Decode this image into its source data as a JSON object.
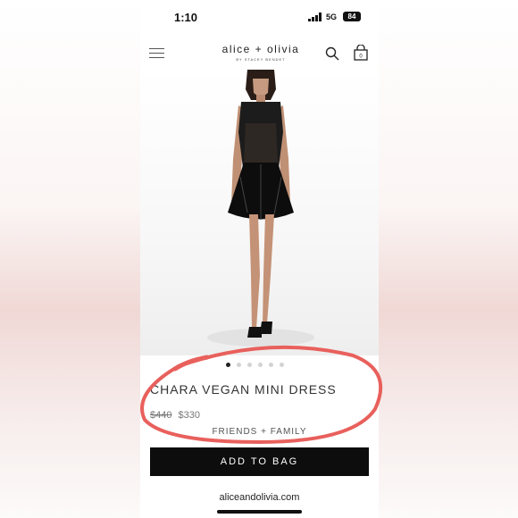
{
  "status_bar": {
    "time": "1:10",
    "network": "5G",
    "battery": "84"
  },
  "header": {
    "logo": "alice + olivia",
    "logo_subtitle": "BY STACEY BENDET",
    "bag_count": "0"
  },
  "icons": {
    "menu": "menu-icon",
    "search": "search-icon",
    "bag": "bag-icon"
  },
  "product": {
    "title": "CHARA VEGAN MINI DRESS",
    "original_price": "$440",
    "sale_price": "$330",
    "promo": "FRIENDS + FAMILY",
    "add_to_bag": "ADD TO BAG",
    "image_count": 6,
    "active_image": 1
  },
  "browser": {
    "url": "aliceandolivia.com"
  },
  "annotation": {
    "circle_color": "#e8605c"
  }
}
